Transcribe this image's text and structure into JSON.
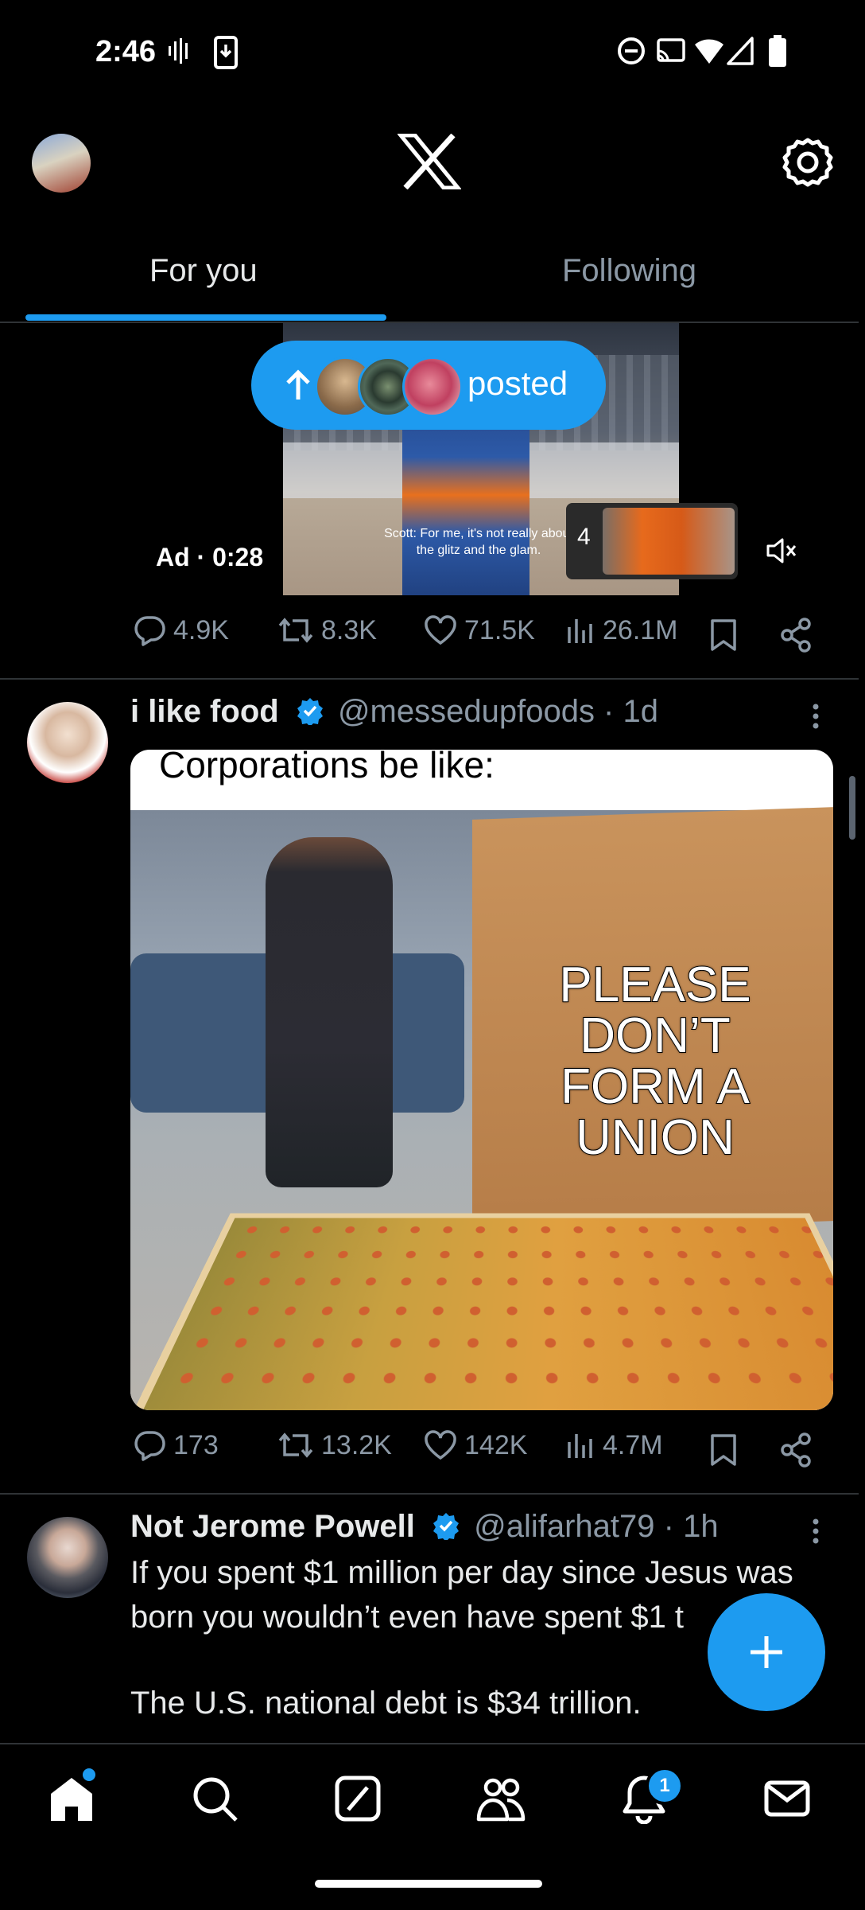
{
  "status_bar": {
    "time": "2:46"
  },
  "header": {
    "app": "X"
  },
  "tabs": [
    {
      "label": "For you",
      "active": true
    },
    {
      "label": "Following",
      "active": false
    }
  ],
  "ad": {
    "label": "Ad · 0:28",
    "caption": "Scott: For me, it's not really about the glitz and the glam.",
    "thumb_count": "4",
    "posted_pill": "posted",
    "stats": {
      "replies": "4.9K",
      "reposts": "8.3K",
      "likes": "71.5K",
      "views": "26.1M"
    }
  },
  "tweets": [
    {
      "name": "i like food",
      "handle": "@messedupfoods · 1d",
      "image_caption": "Corporations be like:",
      "image_lid_text": "PLEASE DON’T FORM A UNION",
      "stats": {
        "replies": "173",
        "reposts": "13.2K",
        "likes": "142K",
        "views": "4.7M"
      }
    },
    {
      "name": "Not Jerome Powell",
      "handle": "@alifarhat79 · 1h",
      "text_line1": "If you spent $1 million per day since Jesus was",
      "text_line2": "born you wouldn’t even have spent $1 t",
      "text_line3": "The U.S. national debt is $34 trillion."
    }
  ],
  "bottom_nav": {
    "notifications_badge": "1"
  },
  "colors": {
    "accent": "#1d9bf0",
    "background": "#000000",
    "muted": "#8b98a5",
    "text": "#e7e9ea"
  }
}
